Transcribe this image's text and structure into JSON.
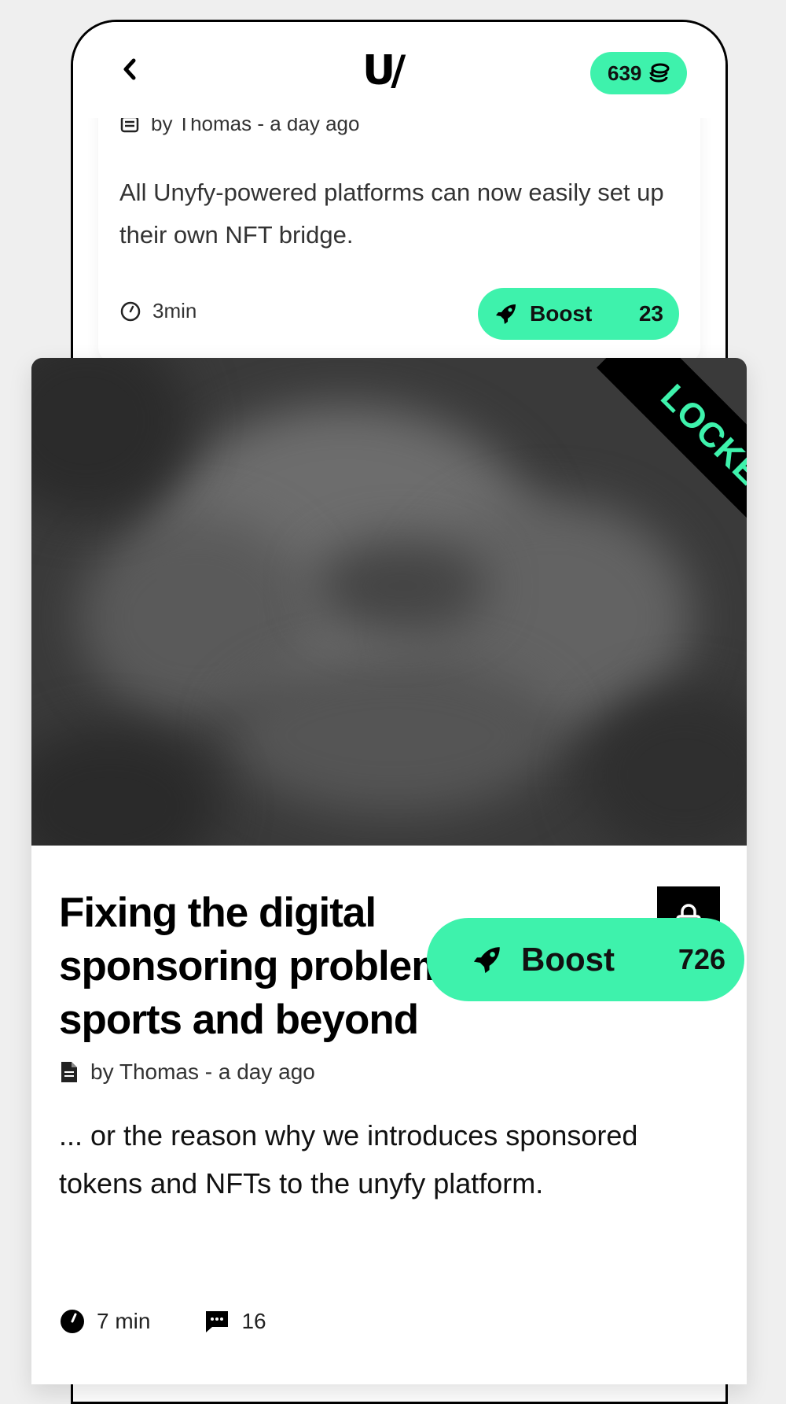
{
  "header": {
    "logo_text": "U/",
    "coins": "639",
    "accent_color": "#3ef2ac"
  },
  "post1": {
    "meta": "by Thomas - a day ago",
    "excerpt": "All Unyfy-powered platforms can now easily set up their own NFT bridge.",
    "read_time": "3min",
    "boost_label": "Boost",
    "boost_count": "23"
  },
  "post2": {
    "ribbon": "LOCKED",
    "title": "Fixing the digital sponsoring problem for sports and beyond",
    "meta": "by Thomas - a day ago",
    "excerpt": "... or the reason why we introduces sponsored tokens and NFTs to the unyfy platform.",
    "read_time": "7 min",
    "comments": "16",
    "boost_label": "Boost",
    "boost_count": "726"
  }
}
